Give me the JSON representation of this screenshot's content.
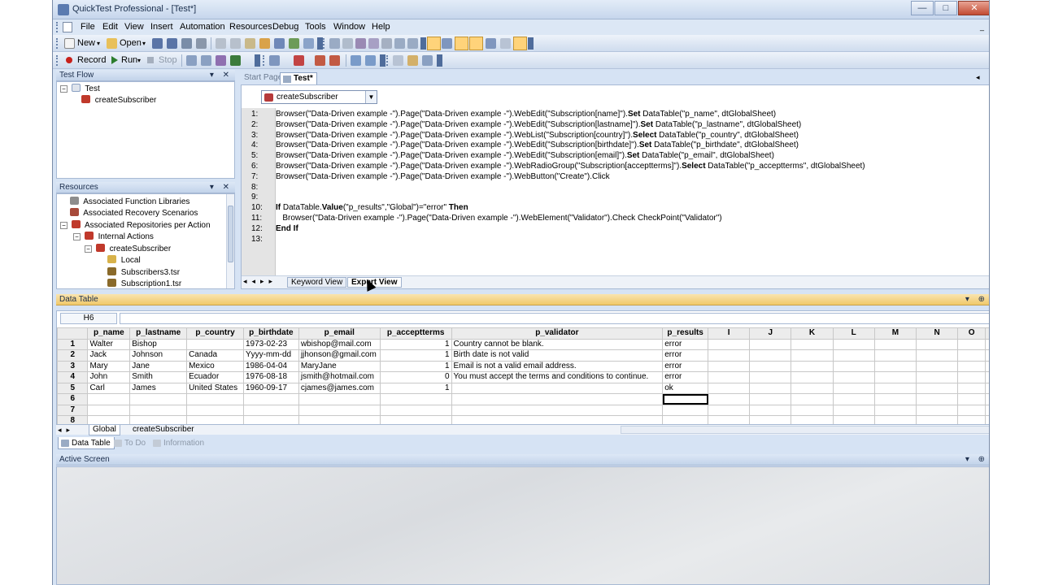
{
  "window": {
    "title": "QuickTest Professional - [Test*]",
    "min": "—",
    "max": "□",
    "close": "✕"
  },
  "menu": [
    "File",
    "Edit",
    "View",
    "Insert",
    "Automation",
    "Resources",
    "Debug",
    "Tools",
    "Window",
    "Help"
  ],
  "toolbar1": {
    "new_label": "New",
    "open_label": "Open"
  },
  "toolbar2": {
    "record_label": "Record",
    "run_label": "Run",
    "stop_label": "Stop"
  },
  "test_flow": {
    "header": "Test Flow",
    "items": [
      {
        "label": "Test",
        "level": 0
      },
      {
        "label": "createSubscriber",
        "level": 1
      }
    ]
  },
  "resources": {
    "header": "Resources",
    "items": [
      {
        "label": "Associated Function Libraries",
        "level": 0
      },
      {
        "label": "Associated Recovery Scenarios",
        "level": 0
      },
      {
        "label": "Associated Repositories per Action",
        "level": 0
      },
      {
        "label": "Internal Actions",
        "level": 1
      },
      {
        "label": "createSubscriber",
        "level": 2
      },
      {
        "label": "Local",
        "level": 3
      },
      {
        "label": "Subscribers3.tsr",
        "level": 3
      },
      {
        "label": "Subscription1.tsr",
        "level": 3
      }
    ]
  },
  "editor": {
    "tabs": [
      {
        "label": "Start Page",
        "active": false
      },
      {
        "label": "Test*",
        "active": true
      }
    ],
    "action": "createSubscriber",
    "lines": [
      {
        "n": "1:",
        "html": "Browser(\"Data-Driven example -\").Page(\"Data-Driven example -\").WebEdit(\"Subscription[name]\").<b>Set</b> DataTable(\"p_name\", dtGlobalSheet)"
      },
      {
        "n": "2:",
        "html": "Browser(\"Data-Driven example -\").Page(\"Data-Driven example -\").WebEdit(\"Subscription[lastname]\").<b>Set</b> DataTable(\"p_lastname\", dtGlobalSheet)"
      },
      {
        "n": "3:",
        "html": "Browser(\"Data-Driven example -\").Page(\"Data-Driven example -\").WebList(\"Subscription[country]\").<b>Select</b> DataTable(\"p_country\", dtGlobalSheet)"
      },
      {
        "n": "4:",
        "html": "Browser(\"Data-Driven example -\").Page(\"Data-Driven example -\").WebEdit(\"Subscription[birthdate]\").<b>Set</b> DataTable(\"p_birthdate\", dtGlobalSheet)"
      },
      {
        "n": "5:",
        "html": "Browser(\"Data-Driven example -\").Page(\"Data-Driven example -\").WebEdit(\"Subscription[email]\").<b>Set</b> DataTable(\"p_email\", dtGlobalSheet)"
      },
      {
        "n": "6:",
        "html": "Browser(\"Data-Driven example -\").Page(\"Data-Driven example -\").WebRadioGroup(\"Subscription[acceptterms]\").<b>Select</b> DataTable(\"p_acceptterms\", dtGlobalSheet)"
      },
      {
        "n": "7:",
        "html": "Browser(\"Data-Driven example -\").Page(\"Data-Driven example -\").WebButton(\"Create\").Click"
      },
      {
        "n": "8:",
        "html": ""
      },
      {
        "n": "9:",
        "html": ""
      },
      {
        "n": "10:",
        "html": "<b>If</b> DataTable.<b>Value</b>(\"p_results\",\"Global\")=\"error\" <b>Then</b>"
      },
      {
        "n": "11:",
        "html": "   Browser(\"Data-Driven example -\").Page(\"Data-Driven example -\").WebElement(\"Validator\").Check CheckPoint(\"Validator\")"
      },
      {
        "n": "12:",
        "html": "<b>End If</b>"
      },
      {
        "n": "13:",
        "html": ""
      }
    ],
    "view_tabs": [
      {
        "label": "Keyword View",
        "active": false
      },
      {
        "label": "Expert View",
        "active": true
      }
    ]
  },
  "data_table": {
    "header": "Data Table",
    "cell_ref": "H6",
    "columns": [
      "p_name",
      "p_lastname",
      "p_country",
      "p_birthdate",
      "p_email",
      "p_acceptterms",
      "p_validator",
      "p_results",
      "I",
      "J",
      "K",
      "L",
      "M",
      "N",
      "O"
    ],
    "rows": [
      [
        "1",
        "Walter",
        "Bishop",
        "",
        "1973-02-23",
        "wbishop@mail.com",
        "1",
        "Country cannot be blank.",
        "error"
      ],
      [
        "2",
        "Jack",
        "Johnson",
        "Canada",
        "Yyyy-mm-dd",
        "jjhonson@gmail.com",
        "1",
        "Birth date is not valid",
        "error"
      ],
      [
        "3",
        "Mary",
        "Jane",
        "Mexico",
        "1986-04-04",
        "MaryJane",
        "1",
        "Email is not a valid email address.",
        "error"
      ],
      [
        "4",
        "John",
        "Smith",
        "Ecuador",
        "1976-08-18",
        "jsmith@hotmail.com",
        "0",
        "You must accept the terms and conditions to continue.",
        "error"
      ],
      [
        "5",
        "Carl",
        "James",
        "United States",
        "1960-09-17",
        "cjames@james.com",
        "1",
        "",
        "ok"
      ],
      [
        "6",
        "",
        "",
        "",
        "",
        "",
        "",
        "",
        ""
      ],
      [
        "7",
        "",
        "",
        "",
        "",
        "",
        "",
        "",
        ""
      ],
      [
        "8",
        "",
        "",
        "",
        "",
        "",
        "",
        "",
        ""
      ]
    ],
    "sheet_tabs": [
      "Global",
      "createSubscriber"
    ]
  },
  "bottom_tabs": [
    {
      "label": "Data Table",
      "active": true
    },
    {
      "label": "To Do",
      "active": false
    },
    {
      "label": "Information",
      "active": false
    }
  ],
  "active_screen": {
    "header": "Active Screen"
  }
}
